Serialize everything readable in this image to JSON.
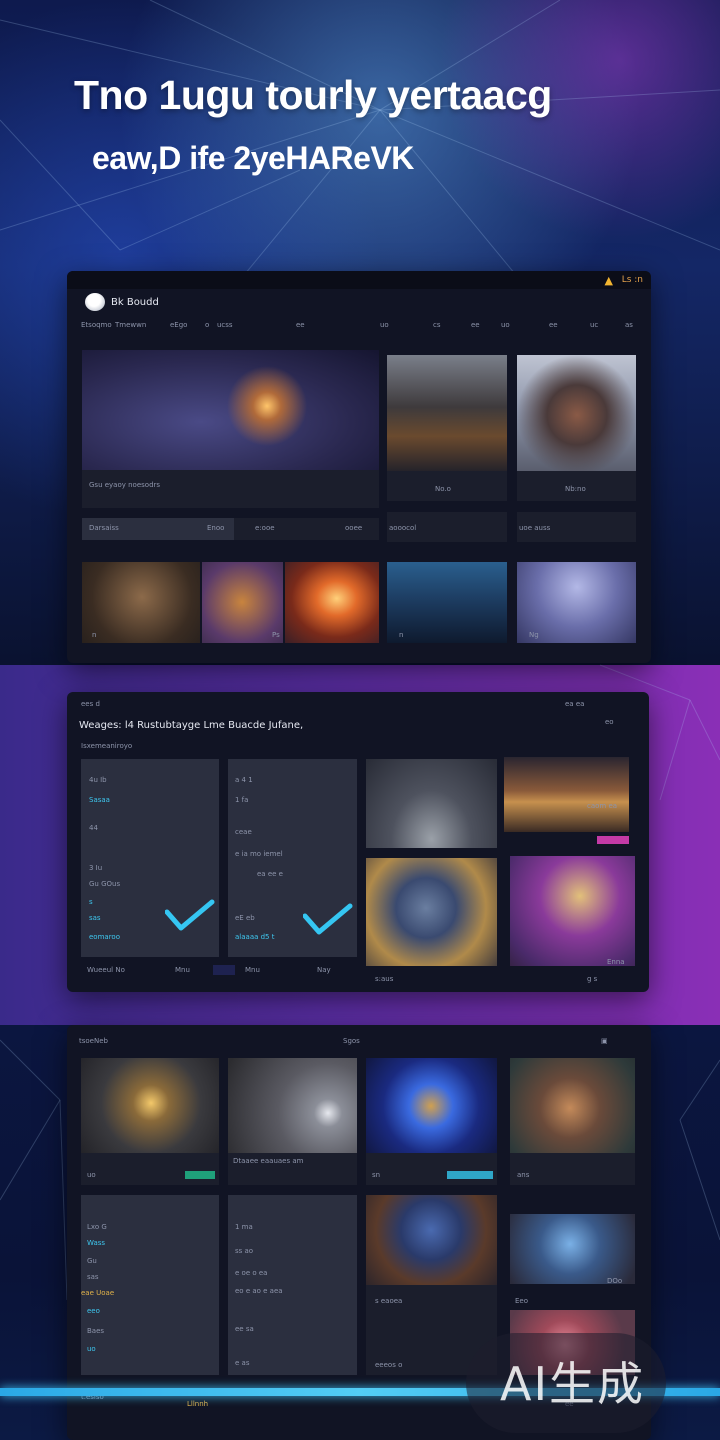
{
  "hero": {
    "headline": "Tno 1ugu tourly yertaacg",
    "subhead": "eaw,D ife 2yeHAReVK"
  },
  "panel1": {
    "brand": "Bk Boudd",
    "warning_label": "Ls :n",
    "nav": [
      "Etsoqmo",
      "Tmewwn",
      "eEgo",
      "o",
      "ucss",
      "ee",
      "uo",
      "cs",
      "ee",
      "uo",
      "ee",
      "uc",
      "as"
    ],
    "hero_caption": "Gsu eyaoy noesodrs",
    "tile_caps": [
      "un oa",
      "No.o",
      "Nb:no"
    ],
    "section_label": "Darsaiss",
    "section_meta": [
      "Enoo",
      "e:ooe",
      "ooee"
    ],
    "side_labels": [
      "aooocol",
      "uoe auss"
    ],
    "strip_caps": [
      "n",
      "Ps",
      "n",
      "Ng"
    ]
  },
  "panel2": {
    "app_label": "ees d",
    "title": "Weages: l4 Rustubtayge Lme Buacde Jufane,",
    "subtitle": "Isxemeaniroyo",
    "card1_rows": [
      "4u Ib",
      "Sasaa",
      "44",
      "3 Iu",
      "Gu GOus",
      "s",
      "sas",
      "eomaroo"
    ],
    "card2_rows": [
      "a 4 1",
      "1 fa",
      "ceae",
      "e ia mo iemel",
      "ea ee e",
      "eE eb",
      "alaaaa d5 t"
    ],
    "footer": [
      "Wueeul No",
      "Mnu",
      "Mnu",
      "Nay"
    ],
    "tile_caps": [
      "Enna",
      "caom ea"
    ],
    "bottom_caps": [
      "s:aus",
      "g s"
    ],
    "small": [
      "ea  ea",
      "eo"
    ]
  },
  "panel3": {
    "left_label": "tsoeNeb",
    "center_label": "Sgos",
    "tile_caps": [
      "uo",
      "Dtaaee eaauaes am",
      "sn",
      "ans"
    ],
    "card1_rows": [
      "Lxo G",
      "Wass",
      "Gu",
      "sas",
      "eae Uoae",
      "eeo",
      "Baes",
      "uo"
    ],
    "card2_rows": [
      "1 ma",
      "ss ao",
      "e oe o ea",
      "eo e ao e aea",
      "ee sa",
      "e as"
    ],
    "card3_caps": [
      "s eaoea",
      "eeeos o"
    ],
    "card4_caps": [
      "Eeo",
      "DOo"
    ],
    "footer": [
      "t.eslso",
      "Lllnnh",
      "ee"
    ]
  },
  "watermark": "AI生成",
  "colors": {
    "accent_cyan": "#3ec7ef",
    "warning": "#f2b531",
    "panel": "#111424",
    "card": "#2b2f3f"
  },
  "icons": [
    "avatar-icon",
    "warning-icon",
    "check-icon"
  ]
}
